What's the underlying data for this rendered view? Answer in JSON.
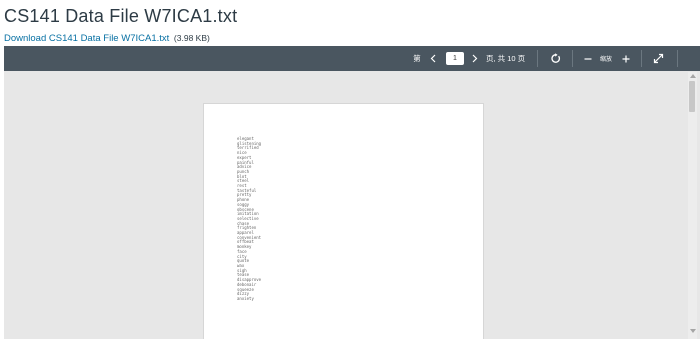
{
  "page": {
    "title": "CS141 Data File W7ICA1.txt"
  },
  "download": {
    "link_label": "Download CS141 Data File W7ICA1.txt",
    "file_size": "(3.98 KB)"
  },
  "toolbar": {
    "page_prefix": "第",
    "current_page": "1",
    "page_suffix": "页, 共 10 页",
    "zoom_label": "缩放",
    "icons": {
      "prev": "chevron-left-icon",
      "next": "chevron-right-icon",
      "rotate": "rotate-icon",
      "zoom_out": "minus-icon",
      "zoom_in": "plus-icon",
      "fullscreen": "expand-icon"
    }
  },
  "document": {
    "words": [
      "elegant",
      "glistening",
      "terrified",
      "nice",
      "expert",
      "painful",
      "advice",
      "punch",
      "blot",
      "steel",
      "rest",
      "tasteful",
      "pretty",
      "phone",
      "soggy",
      "obscene",
      "imitation",
      "selective",
      "chase",
      "frighten",
      "apparel",
      "convenient",
      "offbeat",
      "monkey",
      "face",
      "city",
      "quote",
      "wax",
      "sigh",
      "tease",
      "disapprove",
      "debonair",
      "squeeze",
      "dizzy",
      "anxiety"
    ]
  },
  "colors": {
    "toolbar_bg": "#4a5660",
    "link": "#0770a3",
    "title": "#2d3b45",
    "viewer_bg": "#e7e7e7"
  }
}
